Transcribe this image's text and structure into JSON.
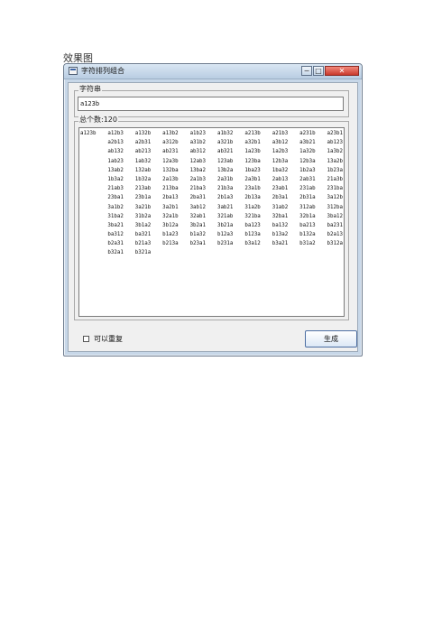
{
  "caption": "效果图",
  "window": {
    "title": "字符排列组合",
    "min_symbol": "−",
    "max_symbol": "□",
    "close_symbol": "✕"
  },
  "input_group": {
    "label": "字符串",
    "value": "a123b"
  },
  "results_group": {
    "label": "总个数:120",
    "items": [
      "a123b",
      "a12b3",
      "a132b",
      "a13b2",
      "a1b23",
      "a1b32",
      "a213b",
      "a21b3",
      "a231b",
      "a23b1",
      "",
      "a2b13",
      "a2b31",
      "a312b",
      "a31b2",
      "a321b",
      "a32b1",
      "a3b12",
      "a3b21",
      "ab123",
      "",
      "ab132",
      "ab213",
      "ab231",
      "ab312",
      "ab321",
      "1a23b",
      "1a2b3",
      "1a32b",
      "1a3b2",
      "",
      "1ab23",
      "1ab32",
      "12a3b",
      "12ab3",
      "123ab",
      "123ba",
      "12b3a",
      "12b3a",
      "13a2b",
      "",
      "13ab2",
      "132ab",
      "132ba",
      "13ba2",
      "13b2a",
      "1ba23",
      "1ba32",
      "1b2a3",
      "1b23a",
      "",
      "1b3a2",
      "1b32a",
      "2a13b",
      "2a1b3",
      "2a31b",
      "2a3b1",
      "2ab13",
      "2ab31",
      "21a3b",
      "",
      "21ab3",
      "213ab",
      "213ba",
      "21ba3",
      "21b3a",
      "23a1b",
      "23ab1",
      "231ab",
      "231ba",
      "",
      "23ba1",
      "23b1a",
      "2ba13",
      "2ba31",
      "2b1a3",
      "2b13a",
      "2b3a1",
      "2b31a",
      "3a12b",
      "",
      "3a1b2",
      "3a21b",
      "3a2b1",
      "3ab12",
      "3ab21",
      "31a2b",
      "31ab2",
      "312ab",
      "312ba",
      "",
      "31ba2",
      "31b2a",
      "32a1b",
      "32ab1",
      "321ab",
      "321ba",
      "32ba1",
      "32b1a",
      "3ba12",
      "",
      "3ba21",
      "3b1a2",
      "3b12a",
      "3b2a1",
      "3b21a",
      "ba123",
      "ba132",
      "ba213",
      "ba231",
      "",
      "ba312",
      "ba321",
      "b1a23",
      "b1a32",
      "b12a3",
      "b123a",
      "b13a2",
      "b132a",
      "b2a13",
      "",
      "b2a31",
      "b21a3",
      "b213a",
      "b23a1",
      "b231a",
      "b3a12",
      "b3a21",
      "b31a2",
      "b312a",
      "",
      "b32a1",
      "b321a",
      "",
      "",
      "",
      "",
      "",
      "",
      ""
    ]
  },
  "options": {
    "repeat_label": "可以重复",
    "repeat_checked": false
  },
  "actions": {
    "generate_label": "生成"
  }
}
